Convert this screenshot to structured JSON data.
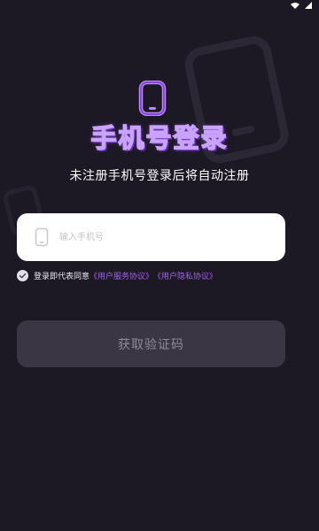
{
  "status_bar": {
    "icons": [
      "wifi-icon",
      "signal-icon"
    ]
  },
  "header": {
    "icon": "phone-icon",
    "title": "手机号登录",
    "subtitle": "未注册手机号登录后将自动注册"
  },
  "phone_field": {
    "icon": "phone-icon",
    "placeholder": "输入手机号",
    "value": ""
  },
  "agreement": {
    "checked": true,
    "text": "登录即代表同意",
    "user_agreement_link": "《用户服务协议》",
    "privacy_link": "《用户隐私协议》"
  },
  "get_code_button": {
    "label": "获取验证码"
  },
  "colors": {
    "background": "#1c1824",
    "accent": "#a05be8",
    "link": "#a562f2",
    "button_disabled_bg": "#3a3644",
    "button_disabled_text": "#8e8a98",
    "input_bg": "#ffffff"
  }
}
